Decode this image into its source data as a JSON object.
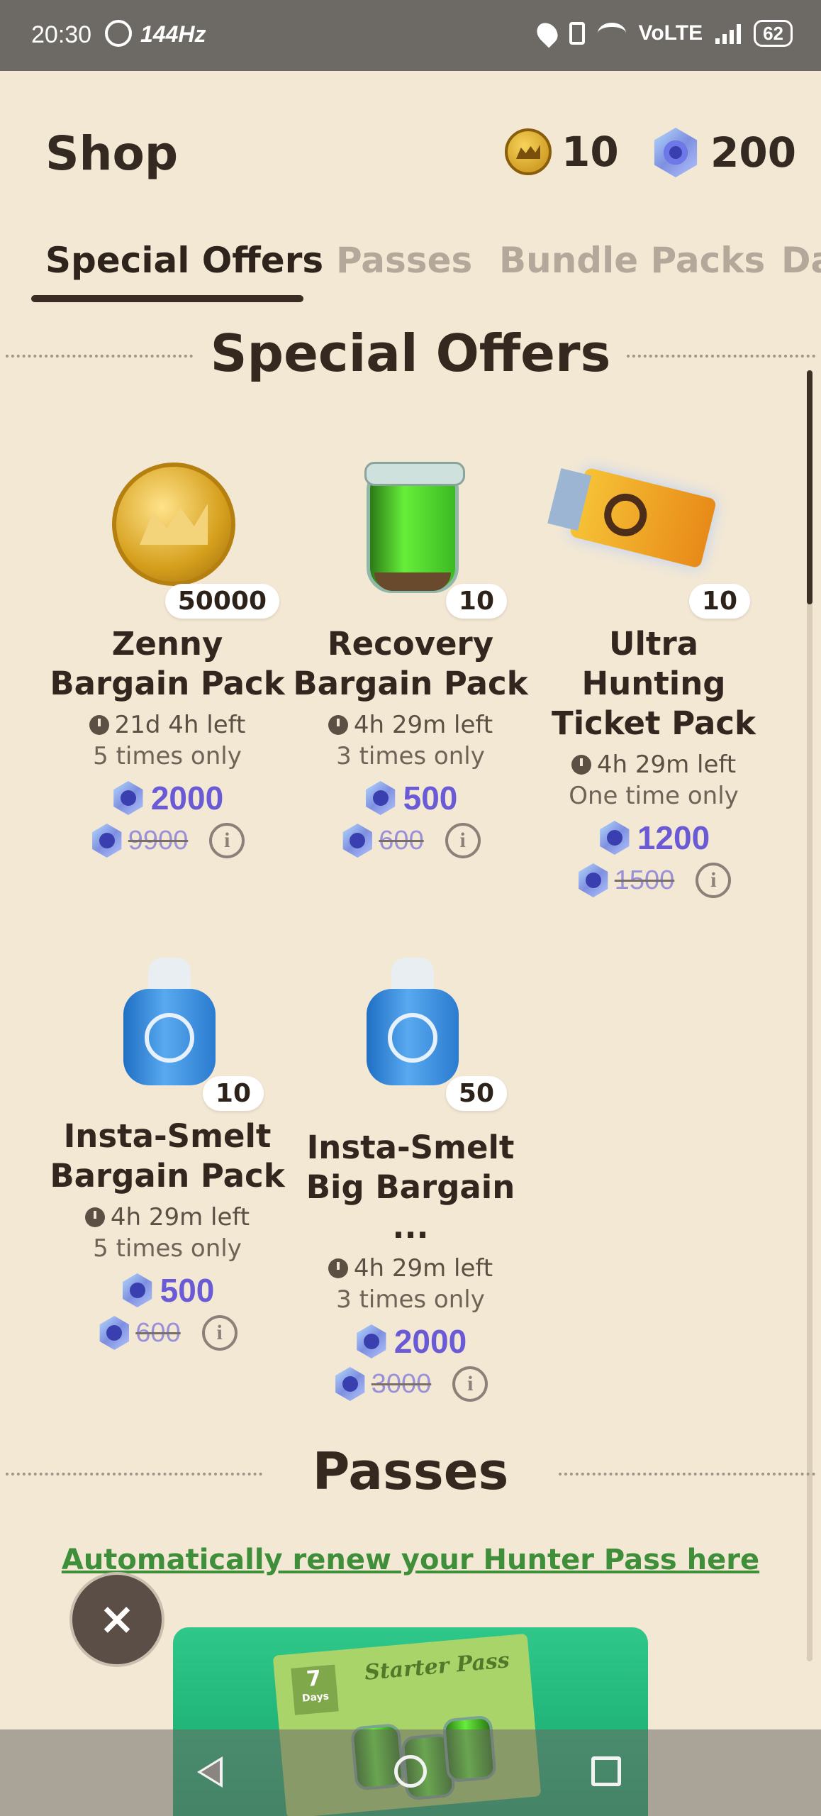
{
  "status_bar": {
    "time": "20:30",
    "refresh_rate": "144Hz",
    "network": "VoLTE",
    "battery": "62"
  },
  "header": {
    "title": "Shop",
    "zenny_count": "10",
    "gem_count": "200"
  },
  "tabs": [
    "Special Offers",
    "Passes",
    "Bundle Packs",
    "Da"
  ],
  "active_tab": "Special Offers",
  "sections": {
    "special_offers_title": "Special Offers",
    "passes_title": "Passes"
  },
  "offers": [
    {
      "quantity": "50000",
      "name_line1": "Zenny",
      "name_line2": "Bargain Pack",
      "time_left": "21d 4h left",
      "limit": "5 times only",
      "price": "2000",
      "old_price": "9900",
      "icon": "zenny-coin-icon"
    },
    {
      "quantity": "10",
      "name_line1": "Recovery",
      "name_line2": "Bargain Pack",
      "time_left": "4h 29m left",
      "limit": "3 times only",
      "price": "500",
      "old_price": "600",
      "icon": "recovery-jar-icon"
    },
    {
      "quantity": "10",
      "name_line1": "Ultra Hunting",
      "name_line2": "Ticket Pack",
      "time_left": "4h 29m left",
      "limit": "One time only",
      "price": "1200",
      "old_price": "1500",
      "icon": "hunting-ticket-icon"
    },
    {
      "quantity": "10",
      "name_line1": "Insta-Smelt",
      "name_line2": "Bargain Pack",
      "time_left": "4h 29m left",
      "limit": "5 times only",
      "price": "500",
      "old_price": "600",
      "icon": "insta-smelt-bottle-icon"
    },
    {
      "quantity": "50",
      "name_line1": "Insta-Smelt",
      "name_line2": "Big Bargain ...",
      "time_left": "4h 29m left",
      "limit": "3 times only",
      "price": "2000",
      "old_price": "3000",
      "icon": "insta-smelt-bottle-icon"
    }
  ],
  "passes": {
    "renew_link": "Automatically renew your Hunter Pass here",
    "banner_days": "7",
    "banner_days_label": "Days",
    "banner_title": "Starter Pass"
  },
  "close_button": "×",
  "colors": {
    "background": "#f3e8d4",
    "price_purple": "#6a5ad6",
    "link_green": "#3e8e3a",
    "pass_green": "#1fb87a"
  }
}
